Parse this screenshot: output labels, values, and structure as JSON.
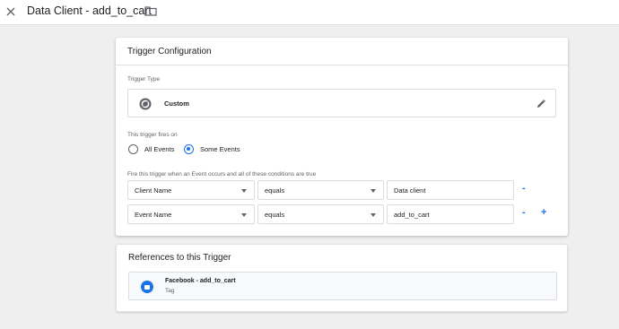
{
  "header": {
    "title": "Data Client - add_to_cart",
    "close_icon": "close-icon",
    "folder_icon": "folder-icon"
  },
  "config": {
    "title": "Trigger Configuration",
    "type_label": "Trigger Type",
    "type_name": "Custom",
    "fires_on_label": "This trigger fires on",
    "radios": [
      {
        "label": "All Events",
        "selected": false
      },
      {
        "label": "Some Events",
        "selected": true
      }
    ],
    "conditions_label": "Fire this trigger when an Event occurs and all of these conditions are true",
    "conditions": [
      {
        "variable": "Client Name",
        "operator": "equals",
        "value": "Data client",
        "remove": "-"
      },
      {
        "variable": "Event Name",
        "operator": "equals",
        "value": "add_to_cart",
        "remove": "-",
        "add": "+"
      }
    ]
  },
  "references": {
    "title": "References to this Trigger",
    "items": [
      {
        "name": "Facebook - add_to_cart",
        "type": "Tag"
      }
    ]
  },
  "colors": {
    "accent": "#1a73e8",
    "background": "#efefef"
  }
}
